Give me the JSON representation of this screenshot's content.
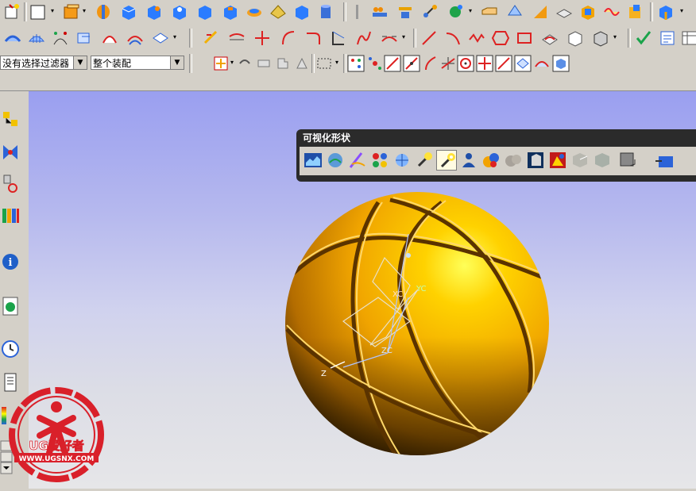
{
  "toolbar": {
    "filter_select": "没有选择过滤器",
    "assembly_select": "整个装配"
  },
  "palette": {
    "title": "可视化形状"
  },
  "wcs": {
    "x_label": "XC",
    "y_label": "YC",
    "z_label": "ZC",
    "abs_z_label": "Z"
  },
  "watermark": {
    "brand": "UG爱好者",
    "url": "WWW.UGSNX.COM"
  },
  "colors": {
    "viewport_top": "#9a9ff0",
    "viewport_bottom": "#e6e6e8",
    "ball": "#f0a400",
    "logo_red": "#d9202a"
  }
}
